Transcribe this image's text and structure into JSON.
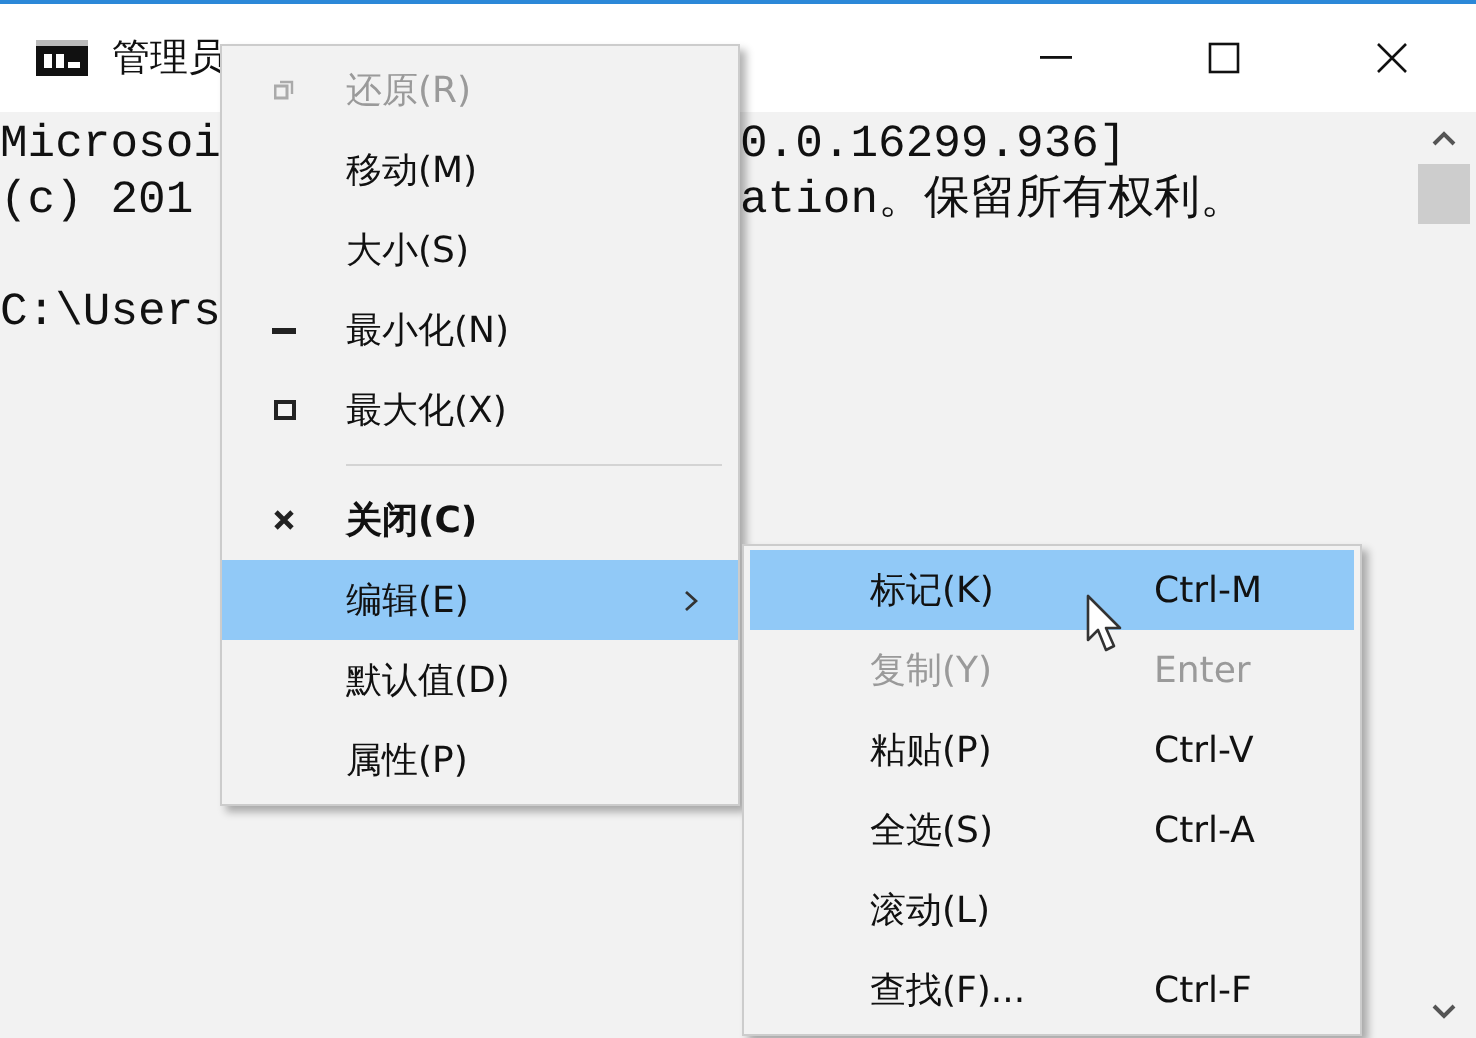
{
  "window": {
    "title": "管理员"
  },
  "console": {
    "lines": [
      {
        "left": "Microsoi",
        "right": "0.0.16299.936]"
      },
      {
        "left": "(c) 201",
        "right": "ation。保留所有权利。"
      },
      {
        "left": "C:\\Users",
        "blank_line_before": true
      }
    ]
  },
  "system_menu": {
    "items": [
      {
        "kind": "restore",
        "label": "还原(R)",
        "disabled": true,
        "selected": false
      },
      {
        "kind": "plain",
        "label": "移动(M)",
        "disabled": false,
        "selected": false
      },
      {
        "kind": "plain",
        "label": "大小(S)",
        "disabled": false,
        "selected": false
      },
      {
        "kind": "minimize",
        "label": "最小化(N)",
        "disabled": false,
        "selected": false
      },
      {
        "kind": "maximize",
        "label": "最大化(X)",
        "disabled": false,
        "selected": false
      },
      {
        "kind": "separator"
      },
      {
        "kind": "close",
        "label": "关闭(C)",
        "disabled": false,
        "selected": false
      },
      {
        "kind": "submenu",
        "label": "编辑(E)",
        "disabled": false,
        "selected": true
      },
      {
        "kind": "plain",
        "label": "默认值(D)",
        "disabled": false,
        "selected": false
      },
      {
        "kind": "plain",
        "label": "属性(P)",
        "disabled": false,
        "selected": false
      }
    ]
  },
  "edit_submenu": {
    "items": [
      {
        "label": "标记(K)",
        "shortcut": "Ctrl-M",
        "disabled": false,
        "selected": true
      },
      {
        "label": "复制(Y)",
        "shortcut": "Enter",
        "disabled": true,
        "selected": false
      },
      {
        "label": "粘贴(P)",
        "shortcut": "Ctrl-V",
        "disabled": false,
        "selected": false
      },
      {
        "label": "全选(S)",
        "shortcut": "Ctrl-A",
        "disabled": false,
        "selected": false
      },
      {
        "label": "滚动(L)",
        "disabled": false,
        "selected": false
      },
      {
        "label": "查找(F)...",
        "shortcut": "Ctrl-F",
        "disabled": false,
        "selected": false
      }
    ]
  }
}
